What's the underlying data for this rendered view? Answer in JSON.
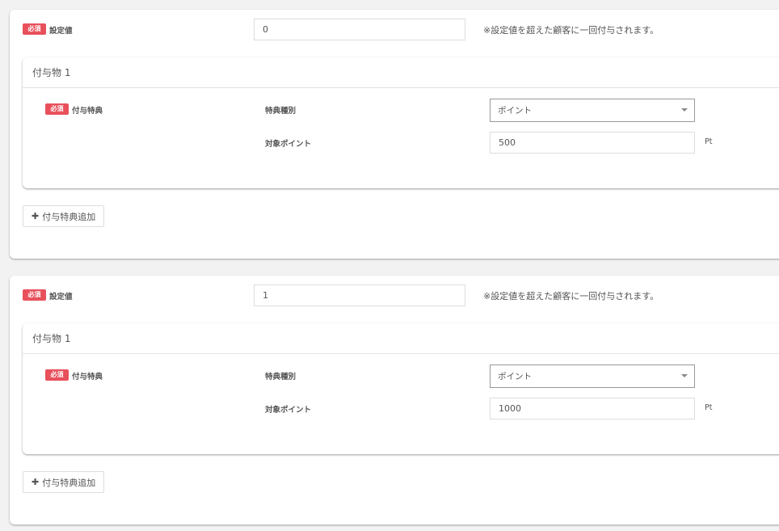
{
  "sections": [
    {
      "required": "必須",
      "label": "設定値",
      "value": "0",
      "note": "※設定値を超えた顧客に一回付与されます。",
      "item": {
        "title": "付与物 1",
        "required": "必須",
        "label": "付与特典",
        "type_label": "特典種別",
        "type_value": "ポイント",
        "points_label": "対象ポイント",
        "points_value": "500",
        "unit": "Pt"
      },
      "add_label": "付与特典追加"
    },
    {
      "required": "必須",
      "label": "設定値",
      "value": "1",
      "note": "※設定値を超えた顧客に一回付与されます。",
      "item": {
        "title": "付与物 1",
        "required": "必須",
        "label": "付与特典",
        "type_label": "特典種別",
        "type_value": "ポイント",
        "points_label": "対象ポイント",
        "points_value": "1000",
        "unit": "Pt"
      },
      "add_label": "付与特典追加"
    }
  ]
}
